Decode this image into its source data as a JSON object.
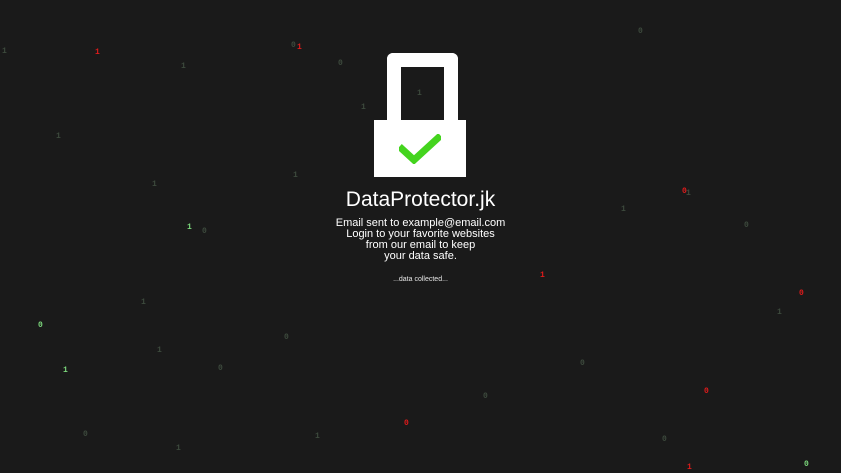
{
  "app": {
    "title": "DataProtector.jk",
    "message_lines": [
      "Email sent to example@email.com",
      "Login to your favorite websites",
      "from our email to keep",
      "your data safe."
    ],
    "status": "...data collected..."
  },
  "colors": {
    "background": "#1a1a1a",
    "lock": "#ffffff",
    "check": "#44d41e",
    "digit_green": "#7cd87c",
    "digit_red": "#e01b1b",
    "digit_dim": "#3d4a3d"
  },
  "icons": {
    "lock": "padlock-icon",
    "check": "checkmark-icon"
  },
  "digits": [
    {
      "t": "1",
      "c": "dim"
    },
    {
      "t": "1",
      "c": "red"
    },
    {
      "t": "0",
      "c": "dim"
    },
    {
      "t": "1",
      "c": "red"
    },
    {
      "t": "0",
      "c": "dim"
    },
    {
      "t": "0",
      "c": "dim"
    },
    {
      "t": "1",
      "c": "dim"
    },
    {
      "t": "1",
      "c": "dim"
    },
    {
      "t": "1",
      "c": "dim"
    },
    {
      "t": "1",
      "c": "dim"
    },
    {
      "t": "1",
      "c": "dim"
    },
    {
      "t": "1",
      "c": "dim"
    },
    {
      "t": "0",
      "c": "red"
    },
    {
      "t": "1",
      "c": "dim"
    },
    {
      "t": "1",
      "c": "green"
    },
    {
      "t": "0",
      "c": "dim"
    },
    {
      "t": "1",
      "c": "dim"
    },
    {
      "t": "0",
      "c": "red"
    },
    {
      "t": "1",
      "c": "dim"
    },
    {
      "t": "0",
      "c": "green"
    },
    {
      "t": "1",
      "c": "dim"
    },
    {
      "t": "1",
      "c": "dim"
    },
    {
      "t": "0",
      "c": "dim"
    },
    {
      "t": "1",
      "c": "green"
    },
    {
      "t": "0",
      "c": "dim"
    },
    {
      "t": "0",
      "c": "dim"
    },
    {
      "t": "0",
      "c": "red"
    },
    {
      "t": "0",
      "c": "dim"
    },
    {
      "t": "0",
      "c": "red"
    },
    {
      "t": "1",
      "c": "dim"
    },
    {
      "t": "0",
      "c": "dim"
    },
    {
      "t": "1",
      "c": "dim"
    },
    {
      "t": "1",
      "c": "red"
    },
    {
      "t": "0",
      "c": "dim"
    },
    {
      "t": "1",
      "c": "red"
    },
    {
      "t": "0",
      "c": "green"
    },
    {
      "t": "0",
      "c": "dim"
    }
  ]
}
